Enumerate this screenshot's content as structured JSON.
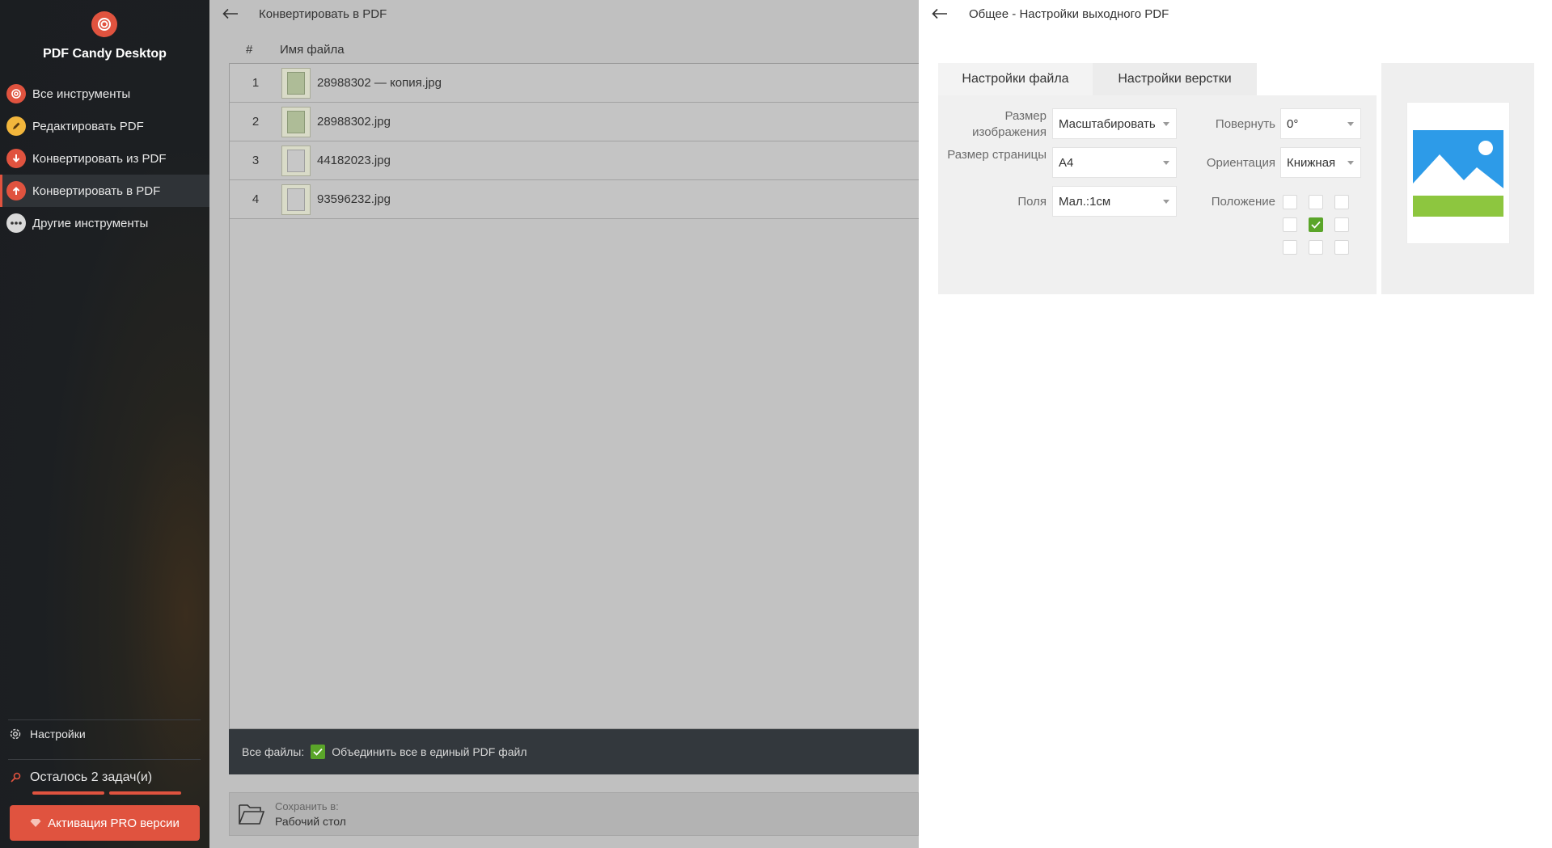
{
  "sidebar": {
    "app_title": "PDF Candy Desktop",
    "logo_icon": "candy-logo-icon",
    "items": [
      {
        "label": "Все инструменты",
        "icon": "all-tools-icon",
        "active": false
      },
      {
        "label": "Редактировать PDF",
        "icon": "edit-pencil-icon",
        "active": false
      },
      {
        "label": "Конвертировать из PDF",
        "icon": "arrow-down-icon",
        "active": false
      },
      {
        "label": "Конвертировать в PDF",
        "icon": "arrow-up-icon",
        "active": true
      },
      {
        "label": "Другие инструменты",
        "icon": "more-dots-icon",
        "active": false
      }
    ],
    "settings_label": "Настройки",
    "tasks_label": "Осталось 2 задач(и)",
    "pro_button": "Активация PRO версии",
    "accent_color": "#e0533f"
  },
  "middle": {
    "title": "Конвертировать в PDF",
    "columns": {
      "num": "#",
      "name": "Имя файла"
    },
    "files": [
      {
        "num": "1",
        "name": "28988302 — копия.jpg"
      },
      {
        "num": "2",
        "name": "28988302.jpg"
      },
      {
        "num": "3",
        "name": "44182023.jpg"
      },
      {
        "num": "4",
        "name": "93596232.jpg"
      }
    ],
    "all_files_label": "Все файлы:",
    "merge_label": "Объединить все в единый PDF файл",
    "merge_checked": true,
    "save_to_label": "Сохранить в:",
    "save_to_value": "Рабочий стол"
  },
  "right": {
    "title": "Общее - Настройки выходного PDF",
    "tabs": [
      "Настройки файла",
      "Настройки верстки"
    ],
    "fields": {
      "image_size_label": "Размер изображения",
      "image_size_value": "Масштабировать",
      "page_size_label": "Размер страницы",
      "page_size_value": "A4",
      "margins_label": "Поля",
      "margins_value": "Мал.:1см",
      "rotate_label": "Повернуть",
      "rotate_value": "0°",
      "orientation_label": "Ориентация",
      "orientation_value": "Книжная",
      "position_label": "Положение",
      "position_selected": "center"
    },
    "preview": {
      "sky_color": "#2d9be8",
      "bar_color": "#8dc63f"
    }
  }
}
